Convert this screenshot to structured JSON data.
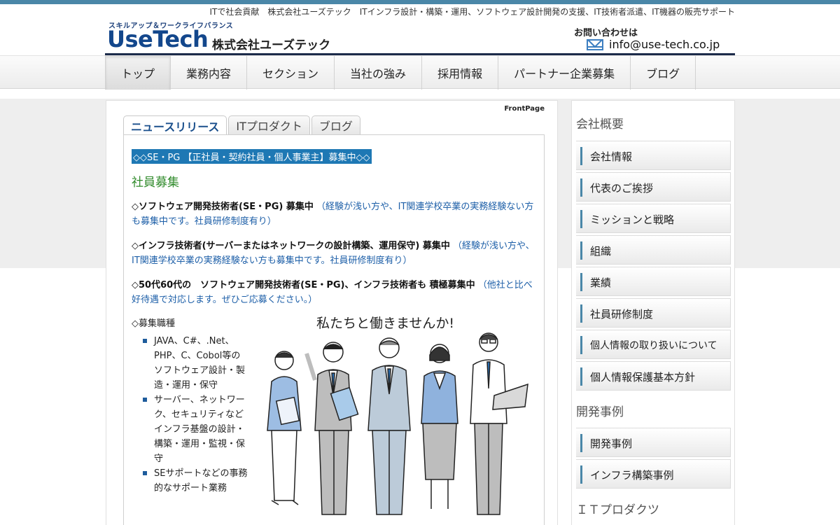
{
  "header": {
    "tagline": "ITで社会貢献　株式会社ユーズテック　ITインフラ設計・構築・運用、ソフトウェア設計開発の支援、IT技術者派遣、IT機器の販売サポート",
    "logo_sub": "スキルアップ＆ワークライフバランス",
    "logo_main": "UseTech",
    "company": "株式会社ユーズテック",
    "contact_label": "お問い合わせは",
    "contact_email": "info@use-tech.co.jp"
  },
  "nav": {
    "items": [
      {
        "label": "トップ"
      },
      {
        "label": "業務内容"
      },
      {
        "label": "セクション"
      },
      {
        "label": "当社の強み"
      },
      {
        "label": "採用情報"
      },
      {
        "label": "パートナー企業募集"
      },
      {
        "label": "ブログ"
      }
    ]
  },
  "main": {
    "frontpage": "FrontPage",
    "tabs": [
      {
        "label": "ニュースリリース"
      },
      {
        "label": "ITプロダクト"
      },
      {
        "label": "ブログ"
      }
    ],
    "highlight": "◇◇SE・PG 【正社員・契約社員・個人事業主】募集中◇◇",
    "section_title": "社員募集",
    "para1_bold": "◇ソフトウェア開発技術者(SE・PG) 募集中",
    "para1_note": "（経験が浅い方や、IT関連学校卒業の実務経験ない方も募集中です。社員研修制度有り）",
    "para2_bold": "◇インフラ技術者(サーバーまたはネットワークの設計構築、運用保守) 募集中",
    "para2_note": "（経験が浅い方や、IT関連学校卒業の実務経験ない方も募集中です。社員研修制度有り）",
    "para3_bold": "◇50代60代の　ソフトウェア開発技術者(SE・PG)、インフラ技術者も 積極募集中",
    "para3_note": "（他社と比べ好待遇で対応します。ぜひご応募ください。）",
    "jobs_label": "◇募集職種",
    "jobs": [
      {
        "line1": "JAVA、C#、.Net、PHP、C、Cobol等のソフトウェア設計・製造・運用・保守"
      },
      {
        "line1": "サーバー、ネットワーク、セキュリティなど",
        "line2": "インフラ基盤の設計・構築・運用・監視・保守"
      },
      {
        "line1": "SEサポートなどの事務的なサポート業務"
      }
    ],
    "illust_caption": "私たちと働きませんか!"
  },
  "sidebar": {
    "company_heading": "会社概要",
    "company_items": [
      {
        "label": "会社情報"
      },
      {
        "label": "代表のご挨拶"
      },
      {
        "label": "ミッションと戦略"
      },
      {
        "label": "組織"
      },
      {
        "label": "業績"
      },
      {
        "label": "社員研修制度"
      },
      {
        "label": "個人情報の取り扱いについて"
      },
      {
        "label": "個人情報保護基本方針"
      }
    ],
    "dev_heading": "開発事例",
    "dev_items": [
      {
        "label": "開発事例"
      },
      {
        "label": "インフラ構築事例"
      }
    ],
    "product_heading": "ＩＴプロダクツ"
  },
  "colors": {
    "accent": "#4a87a8",
    "logo": "#13478c",
    "highlight": "#1e78b4",
    "section_title": "#2f8a2a",
    "note": "#1d5fa8"
  }
}
